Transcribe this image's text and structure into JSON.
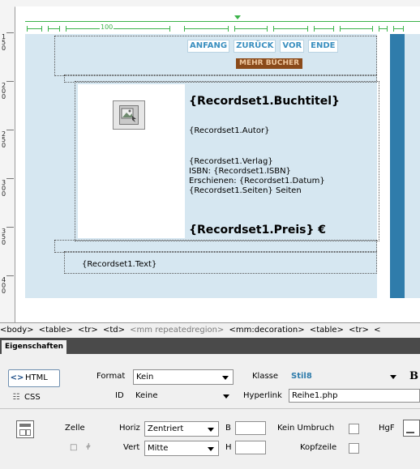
{
  "ruler": {
    "vertical_labels": [
      "1 5 0",
      "2 0 0",
      "2 5 0",
      "3 0 0",
      "3 5 0",
      "4 0 0"
    ],
    "column_label": "100"
  },
  "design": {
    "nav_buttons": [
      "ANFANG",
      "ZURÜCK",
      "VOR",
      "ENDE"
    ],
    "more_books": "MEHR BÜCHER",
    "book_title": "{Recordset1.Buchtitel}",
    "author": "{Recordset1.Autor}",
    "publisher": "{Recordset1.Verlag}",
    "isbn": "ISBN: {Recordset1.ISBN}",
    "published": "Erschienen: {Recordset1.Datum}",
    "pages": "{Recordset1.Seiten} Seiten",
    "price": "{Recordset1.Preis} €",
    "text": "{Recordset1.Text}",
    "colors": {
      "cell_background": "#d6e7f1",
      "right_stripe": "#2f7cab",
      "nav_text": "#3a8fbf",
      "more_books_bg": "#8a4a1a",
      "ruler_green": "#3cb34a"
    }
  },
  "tagbar": {
    "tags": [
      "<body>",
      "<table>",
      "<tr>",
      "<td>",
      "<mm repeatedregion>",
      "<mm:decoration>",
      "<table>",
      "<tr>",
      "<"
    ]
  },
  "properties": {
    "tab": "Eigenschaften",
    "html_label": "HTML",
    "css_label": "CSS",
    "format_label": "Format",
    "format_value": "Kein",
    "id_label": "ID",
    "id_value": "Keine",
    "class_label": "Klasse",
    "class_value": "Stil8",
    "link_label": "Hyperlink",
    "link_value": "Reihe1.php",
    "bold_glyph": "B",
    "cell_label": "Zelle",
    "horiz_label": "Horiz",
    "horiz_value": "Zentriert",
    "vert_label": "Vert",
    "vert_value": "Mitte",
    "width_label": "B",
    "width_value": "",
    "height_label": "H",
    "height_value": "",
    "nowrap_label": "Kein Umbruch",
    "header_label": "Kopfzeile",
    "bg_label": "HgF"
  }
}
